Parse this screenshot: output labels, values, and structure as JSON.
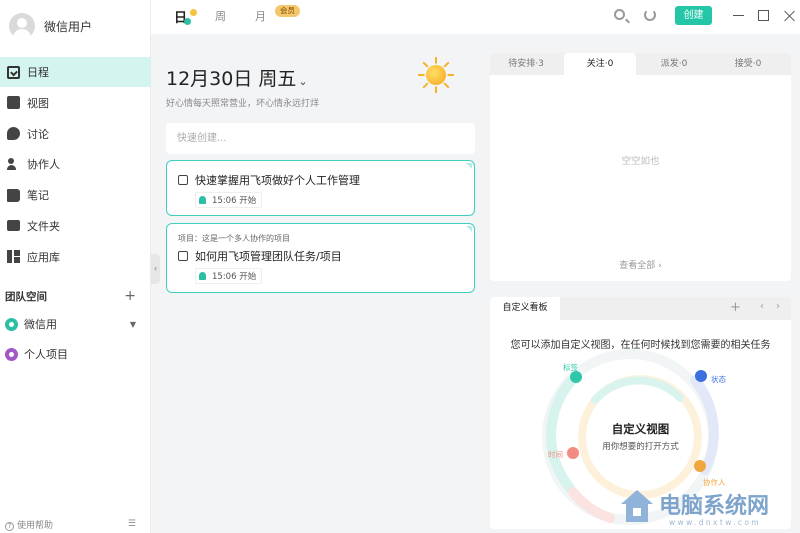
{
  "sidebar": {
    "user_name": "微信用户",
    "nav": [
      {
        "label": "日程",
        "icon": "calendar-check-icon"
      },
      {
        "label": "视图",
        "icon": "chart-icon"
      },
      {
        "label": "讨论",
        "icon": "chat-icon"
      },
      {
        "label": "协作人",
        "icon": "people-icon"
      },
      {
        "label": "笔记",
        "icon": "notebook-icon"
      },
      {
        "label": "文件夹",
        "icon": "folder-icon"
      },
      {
        "label": "应用库",
        "icon": "apps-icon"
      }
    ],
    "team_title": "团队空间",
    "team_add": "+",
    "teams": [
      {
        "label": "微信用",
        "caret": "▼"
      },
      {
        "label": "个人项目"
      }
    ],
    "help_icon": "?",
    "help": "使用帮助",
    "menu_glyph": "☰"
  },
  "topbar": {
    "day": "日",
    "week": "周",
    "month": "月",
    "vip": "会员",
    "create": "创建"
  },
  "main": {
    "date": "12月30日 周五",
    "date_caret": "⌄",
    "motto": "好心情每天照常营业，坏心情永远打烊",
    "quick_create_placeholder": "快速创建...",
    "collapse_glyph": "‹",
    "tasks": [
      {
        "project": "",
        "title": "快速掌握用飞项做好个人工作管理",
        "time": "15:06 开始"
      },
      {
        "project": "项目：这是一个多人协作的项目",
        "title": "如何用飞项管理团队任务/项目",
        "time": "15:06 开始"
      }
    ]
  },
  "status_panel": {
    "tabs": [
      "待安排·3",
      "关注·0",
      "派发·0",
      "接受·0"
    ],
    "empty": "空空如也",
    "view_all": "查看全部 ›"
  },
  "board": {
    "tab": "自定义看板",
    "add": "+",
    "prev": "‹",
    "next": "›",
    "desc": "您可以添加自定义视图，在任何时候找到您需要的相关任务",
    "center_title": "自定义视图",
    "center_sub": "用你想要的打开方式",
    "nodes": [
      {
        "label": "标签",
        "color": "#2ec8a8"
      },
      {
        "label": "状态",
        "color": "#3b6fe0"
      },
      {
        "label": "时间",
        "color": "#f28b82"
      },
      {
        "label": "协作人",
        "color": "#f0a742"
      }
    ]
  },
  "watermark": {
    "title": "电脑系统网",
    "url": "www.dnxtw.com"
  },
  "colors": {
    "accent": "#24c6a8",
    "active_nav_bg": "#d4f4ef",
    "card_border": "#3fd0bc"
  }
}
